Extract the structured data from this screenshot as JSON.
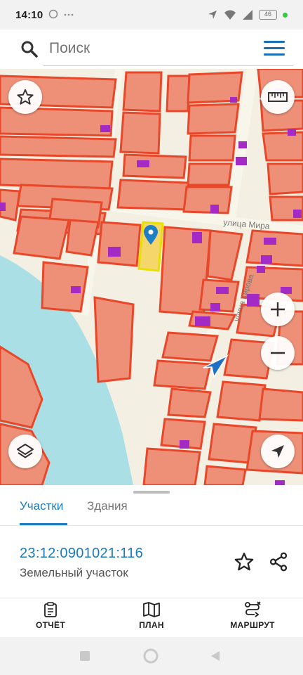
{
  "status_bar": {
    "time": "14:10",
    "battery": "46",
    "icons": [
      "whatsapp-icon",
      "more-dots-icon",
      "location-arrow-icon",
      "wifi-icon",
      "signal-icon",
      "battery-icon"
    ]
  },
  "search": {
    "placeholder": "Поиск",
    "icon": "search-icon",
    "menu_icon": "hamburger-menu-icon"
  },
  "map": {
    "labels": [
      "улица Мира",
      "улица Кирова"
    ],
    "marker_icon": "location-pin-icon",
    "buttons": [
      "favorite-star-icon",
      "ruler-icon",
      "zoom-in-icon",
      "zoom-out-icon",
      "layers-icon",
      "my-location-icon"
    ],
    "colors": {
      "parcel_fill": "#ee9078",
      "parcel_border": "#e8472a",
      "building": "#a32ac4",
      "selected_fill": "#f5d66b",
      "selected_border": "#e8e100",
      "water": "#aadfe6",
      "land": "#f3efe2",
      "marker": "#1f7fc5"
    }
  },
  "sheet": {
    "tabs": [
      {
        "label": "Участки",
        "active": true
      },
      {
        "label": "Здания",
        "active": false
      }
    ],
    "parcel_id": "23:12:0901021:116",
    "parcel_type": "Земельный участок",
    "accent_color": "#1a7bbf"
  },
  "actions": [
    {
      "label": "ОТЧЁТ",
      "icon": "report-clipboard-icon"
    },
    {
      "label": "ПЛАН",
      "icon": "map-plan-icon"
    },
    {
      "label": "МАРШРУТ",
      "icon": "route-icon"
    }
  ],
  "nav": [
    "recents-square-icon",
    "home-circle-icon",
    "back-triangle-icon"
  ]
}
